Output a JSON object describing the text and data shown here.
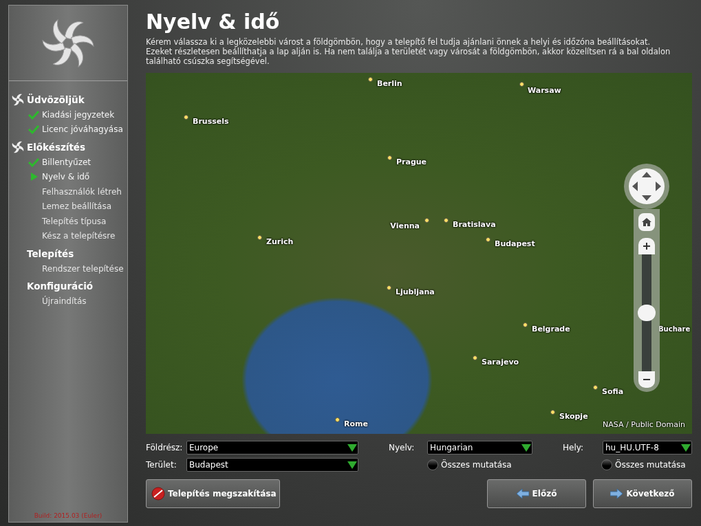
{
  "sidebar": {
    "build": "Build: 2015.03 (Euler)",
    "sections": [
      {
        "title": "Üdvözöljük",
        "reached": true,
        "items": [
          {
            "label": "Kiadási jegyzetek",
            "kind": "done"
          },
          {
            "label": "Licenc jóváhagyása",
            "kind": "done"
          }
        ]
      },
      {
        "title": "Előkészítés",
        "reached": true,
        "items": [
          {
            "label": "Billentyűzet",
            "kind": "done"
          },
          {
            "label": "Nyelv & idő",
            "kind": "current"
          },
          {
            "label": "Felhasználók létreh",
            "kind": "pending"
          },
          {
            "label": "Lemez beállítása",
            "kind": "pending"
          },
          {
            "label": "Telepítés típusa",
            "kind": "pending"
          },
          {
            "label": "Kész a telepítésre",
            "kind": "pending"
          }
        ]
      },
      {
        "title": "Telepítés",
        "reached": false,
        "items": [
          {
            "label": "Rendszer telepítése",
            "kind": "pending"
          }
        ]
      },
      {
        "title": "Konfiguráció",
        "reached": false,
        "items": [
          {
            "label": "Újraindítás",
            "kind": "pending"
          }
        ]
      }
    ]
  },
  "title": "Nyelv & idő",
  "description": "Kérem válassza ki a legközelebbi várost a földgömbön, hogy a telepítő fel tudja ajánlani önnek a helyi és időzóna beállításokat. Ezeket részletesen beállíthatja a lap alján is. Ha nem találja a területét vagy városát a földgömbön, akkor közelítsen rá a bal oldalon található csúszka segítségével.",
  "map": {
    "cities": [
      "Berlin",
      "Warsaw",
      "Brussels",
      "Prague",
      "Zurich",
      "Vienna",
      "Bratislava",
      "Budapest",
      "Ljubljana",
      "Belgrade",
      "Buchare",
      "Sarajevo",
      "Sofia",
      "Skopje",
      "Rome"
    ],
    "zoom": {
      "level": 0.5
    },
    "attribution": "NASA / Public Domain"
  },
  "form": {
    "continent": {
      "label": "Földrész:",
      "value": "Europe"
    },
    "region": {
      "label": "Terület:",
      "value": "Budapest"
    },
    "language": {
      "label": "Nyelv:",
      "value": "Hungarian",
      "show_all": {
        "label": "Összes mutatása",
        "checked": false
      }
    },
    "locale": {
      "label": "Hely:",
      "value": "hu_HU.UTF-8",
      "show_all": {
        "label": "Összes mutatása",
        "checked": false
      }
    }
  },
  "buttons": {
    "abort": "Telepítés megszakítása",
    "back": "Előző",
    "next": "Következő"
  }
}
